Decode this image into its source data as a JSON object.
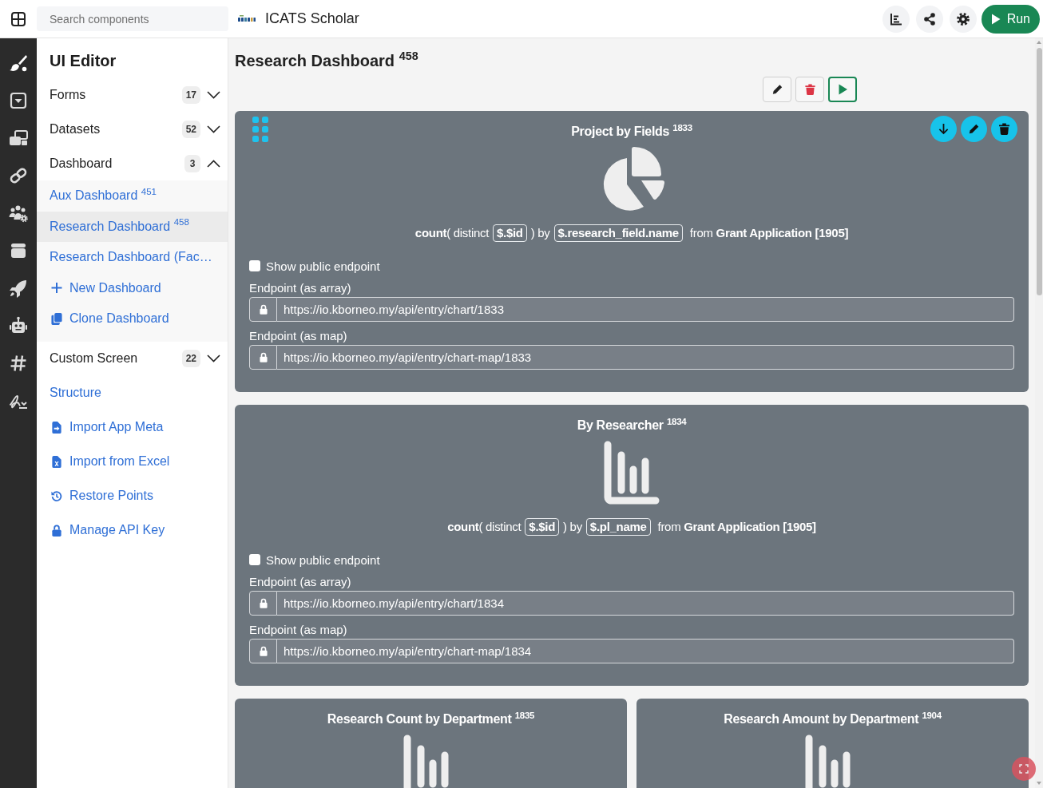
{
  "topbar": {
    "search": {
      "placeholder": "Search components"
    },
    "title": "ICATS Scholar",
    "run_button": "Run"
  },
  "sidebar": {
    "title": "UI Editor",
    "items": [
      {
        "kind": "group",
        "label": "Forms",
        "count": "17",
        "expanded": false
      },
      {
        "kind": "group",
        "label": "Datasets",
        "count": "52",
        "expanded": false
      },
      {
        "kind": "group",
        "label": "Dashboard",
        "count": "3",
        "expanded": true,
        "children": [
          {
            "label": "Aux Dashboard $^{451}$",
            "selected": false
          },
          {
            "label": "Research Dashboard $^{458}$",
            "selected": true
          },
          {
            "label": "Research Dashboard (Fac…",
            "selected": false
          }
        ],
        "actions": [
          {
            "kind": "add",
            "label": "New Dashboard"
          },
          {
            "kind": "clone",
            "label": "Clone Dashboard"
          }
        ]
      },
      {
        "kind": "group",
        "label": "Custom Screen",
        "count": "22",
        "expanded": false
      },
      {
        "kind": "plain",
        "label": "Structure"
      },
      {
        "kind": "import",
        "label": "Import App Meta"
      },
      {
        "kind": "excel",
        "label": "Import from Excel"
      },
      {
        "kind": "history",
        "label": "Restore Points"
      },
      {
        "kind": "lock",
        "label": "Manage API Key"
      }
    ]
  },
  "dashboard": {
    "title": "Research Dashboard $^{458}$",
    "rows": [
      {
        "cards": [
          {
            "title": "Project by Fields $^{1833}$",
            "kind": "pie",
            "hovered": true,
            "query": {
              "prefix": "**count**( distinct",
              "field": "$.$id",
              "middle": ") by",
              "group": "$.research_field.name",
              "suffix": "from **Grant Application [1905]**"
            },
            "public_endpoint": {
              "label": "Show public endpoint",
              "checked": false
            },
            "endpoints": [
              {
                "label": "Endpoint (as array)",
                "url": "https://io.kborneo.my/api/entry/chart/1833"
              },
              {
                "label": "Endpoint (as map)",
                "url": "https://io.kborneo.my/api/entry/chart-map/1833"
              }
            ]
          }
        ]
      },
      {
        "cards": [
          {
            "title": "By Researcher $^{1834}$",
            "kind": "bar",
            "hovered": false,
            "query": {
              "prefix": "**count**( distinct",
              "field": "$.$id",
              "middle": ") by",
              "group": "$.pl_name",
              "suffix": "from **Grant Application [1905]**"
            },
            "public_endpoint": {
              "label": "Show public endpoint",
              "checked": false
            },
            "endpoints": [
              {
                "label": "Endpoint (as array)",
                "url": "https://io.kborneo.my/api/entry/chart/1834"
              },
              {
                "label": "Endpoint (as map)",
                "url": "https://io.kborneo.my/api/entry/chart-map/1834"
              }
            ]
          }
        ]
      },
      {
        "cards": [
          {
            "title": "Research Count by Department $^{1835}$",
            "kind": "bar",
            "hovered": false
          },
          {
            "title": "Research Amount by Department $^{1904}$",
            "kind": "bar",
            "hovered": false
          }
        ]
      }
    ]
  }
}
